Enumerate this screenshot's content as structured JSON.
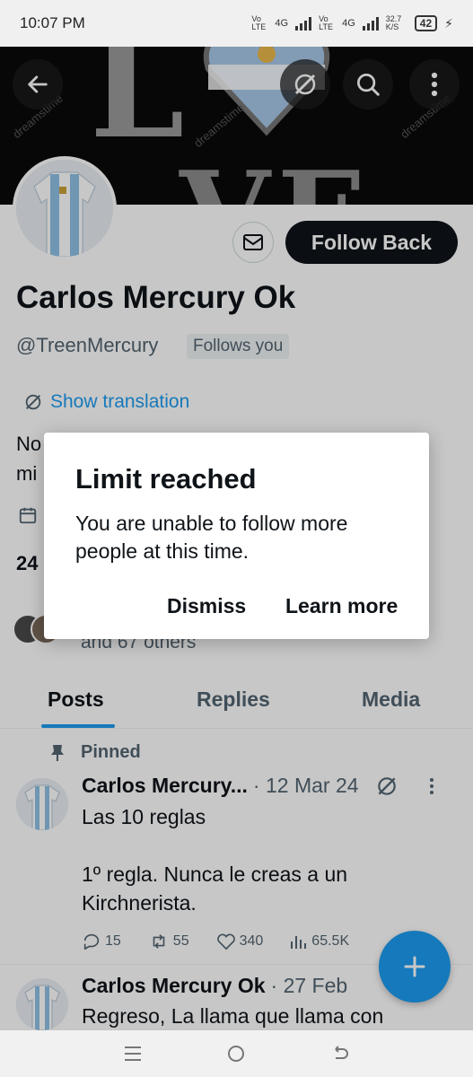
{
  "status_bar": {
    "time": "10:07 PM",
    "network1": "Vo LTE",
    "net_type1": "4G",
    "network2": "Vo LTE",
    "net_type2": "4G",
    "speed": "32.7 K/S",
    "battery": "42"
  },
  "banner": {
    "letters_top": "L",
    "letters_bottom": "VE",
    "watermark": "dreamstime"
  },
  "profile": {
    "follow_back_label": "Follow Back",
    "name": "Carlos Mercury Ok",
    "handle": "@TreenMercury",
    "follows_you_badge": "Follows you",
    "show_translation_label": "Show translation",
    "bio_line1": "No",
    "bio_line2": "mi",
    "counts_partial": "24",
    "followed_by_others": "and 67 others"
  },
  "tabs": [
    {
      "label": "Posts",
      "active": true
    },
    {
      "label": "Replies",
      "active": false
    },
    {
      "label": "Media",
      "active": false
    }
  ],
  "posts": [
    {
      "pinned_label": "Pinned",
      "author": "Carlos Mercury...",
      "date": "· 12 Mar 24",
      "text_line1": "Las 10 reglas",
      "text_line2": "1º regla. Nunca le creas a un",
      "text_line3": "Kirchnerista.",
      "replies": "15",
      "reposts": "55",
      "likes": "340",
      "views": "65.5K"
    },
    {
      "author": "Carlos Mercury Ok",
      "date": "· 27 Feb",
      "text_line1": "Regreso, La llama que llama con"
    }
  ],
  "dialog": {
    "title": "Limit reached",
    "message": "You are unable to follow more people at this time.",
    "dismiss_label": "Dismiss",
    "learn_more_label": "Learn more"
  },
  "colors": {
    "accent": "#1d9bf0",
    "text_primary": "#0f1419",
    "text_secondary": "#536471",
    "follow_button_bg": "#0f1419"
  }
}
